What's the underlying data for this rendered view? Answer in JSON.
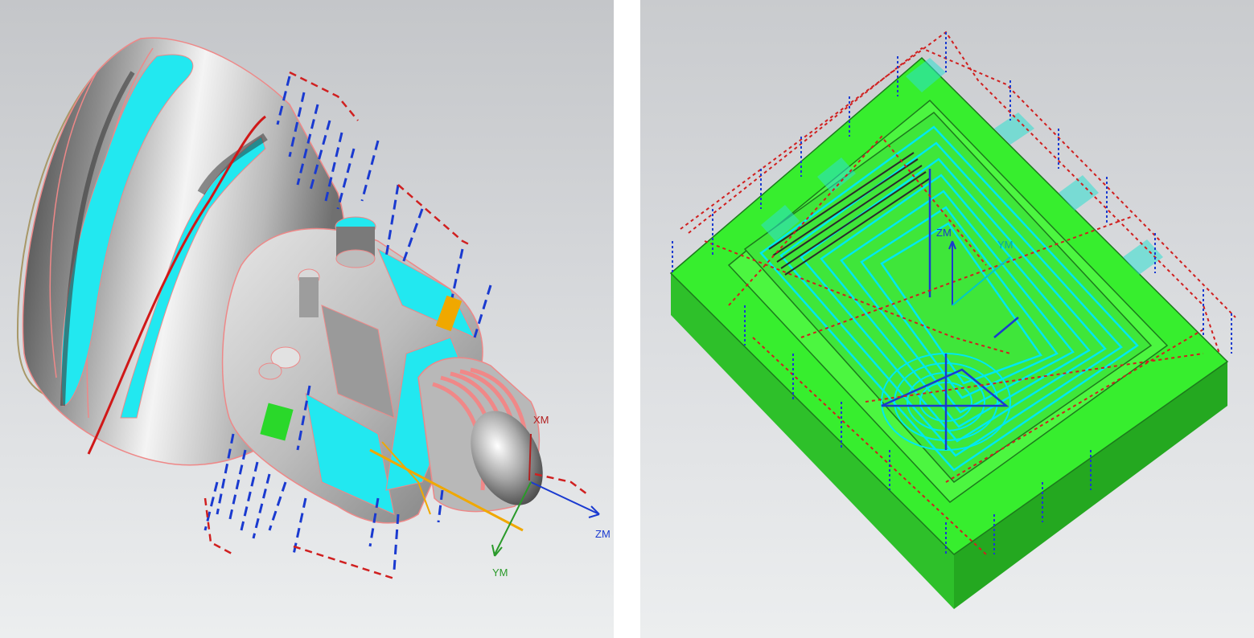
{
  "left_view": {
    "axis_labels": {
      "x": "XM",
      "y": "YM",
      "z": "ZM"
    },
    "colors": {
      "x_axis": "#b02020",
      "y_axis": "#2a9a2a",
      "z_axis": "#1a3ad0"
    }
  },
  "right_view": {
    "axis_labels": {
      "y": "YM",
      "z": "ZM"
    },
    "colors": {
      "part": "#35f02e",
      "toolpath": "#00e8f0",
      "rapid": "#d02020",
      "feed": "#1a3ad0"
    }
  }
}
